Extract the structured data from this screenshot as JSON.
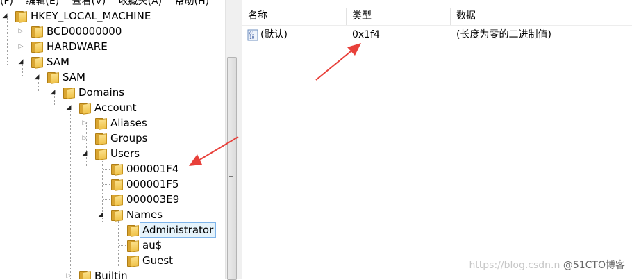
{
  "menubar": [
    "(F)",
    "编辑(E)",
    "查看(V)",
    "收藏夹(A)",
    "帮助(H)"
  ],
  "tree": [
    {
      "label": "HKEY_LOCAL_MACHINE",
      "expanded": true
    },
    {
      "label": "BCD00000000",
      "expanded": false
    },
    {
      "label": "HARDWARE",
      "expanded": false
    },
    {
      "label": "SAM",
      "expanded": true
    },
    {
      "label": "SAM",
      "expanded": true
    },
    {
      "label": "Domains",
      "expanded": true
    },
    {
      "label": "Account",
      "expanded": true
    },
    {
      "label": "Aliases",
      "expanded": false
    },
    {
      "label": "Groups",
      "expanded": false
    },
    {
      "label": "Users",
      "expanded": true
    },
    {
      "label": "000001F4"
    },
    {
      "label": "000001F5"
    },
    {
      "label": "000003E9"
    },
    {
      "label": "Names",
      "expanded": true
    },
    {
      "label": "Administrator",
      "selected": true
    },
    {
      "label": "au$"
    },
    {
      "label": "Guest"
    },
    {
      "label": "Builtin",
      "expanded": false
    }
  ],
  "columns": {
    "name": "名称",
    "type": "类型",
    "data": "数据"
  },
  "values": [
    {
      "name": "(默认)",
      "type": "0x1f4",
      "data": "(长度为零的二进制值)",
      "icon": "binary-value-icon"
    }
  ],
  "annotation_color": "#e8403a",
  "watermark": {
    "prefix": "https://blog.csdn.n",
    "brand": "@51CTO博客"
  }
}
